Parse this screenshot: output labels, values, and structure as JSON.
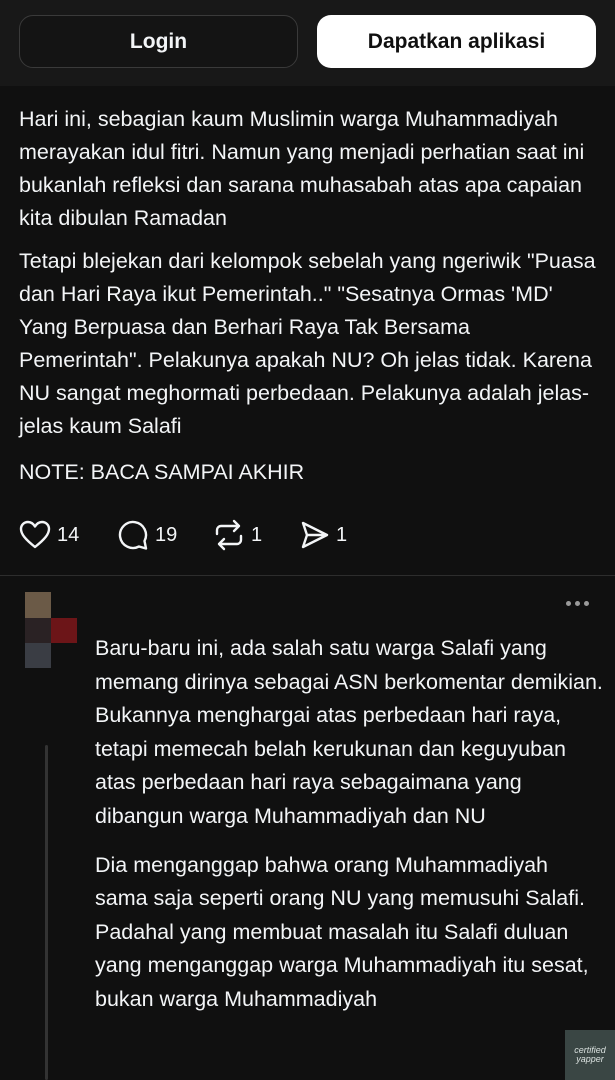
{
  "header": {
    "login_label": "Login",
    "get_app_label": "Dapatkan aplikasi"
  },
  "post": {
    "paragraphs": [
      "Hari ini, sebagian kaum Muslimin warga Muhammadiyah merayakan idul fitri. Namun yang menjadi perhatian saat ini bukanlah refleksi dan sarana muhasabah atas apa capaian kita dibulan Ramadan",
      "Tetapi blejekan dari kelompok sebelah yang ngeriwik \"Puasa dan Hari Raya ikut Pemerintah..\" \"Sesatnya Ormas 'MD' Yang Berpuasa dan Berhari Raya Tak Bersama Pemerintah\". Pelakunya apakah NU? Oh jelas tidak. Karena NU sangat meghormati perbedaan. Pelakunya adalah jelas-jelas kaum Salafi",
      "NOTE: BACA SAMPAI AKHIR"
    ],
    "actions": {
      "likes": "14",
      "comments": "19",
      "reposts": "1",
      "shares": "1"
    }
  },
  "reply": {
    "paragraphs": [
      "Baru-baru ini, ada salah satu warga Salafi yang memang dirinya sebagai ASN berkomentar demikian. Bukannya menghargai atas perbedaan hari raya, tetapi memecah belah kerukunan dan keguyuban atas perbedaan hari raya sebagaimana yang dibangun warga Muhammadiyah dan NU",
      "Dia menganggap bahwa orang Muhammadiyah sama saja seperti orang NU yang memusuhi Salafi. Padahal yang membuat masalah itu Salafi duluan yang menganggap warga Muhammadiyah itu sesat, bukan warga Muhammadiyah"
    ]
  },
  "watermark": "certified yapper",
  "colors": {
    "background": "#101010",
    "text": "#f3f5f7",
    "button_primary_bg": "#ffffff"
  },
  "icons": [
    "heart-icon",
    "comment-icon",
    "repost-icon",
    "share-icon",
    "more-icon"
  ]
}
